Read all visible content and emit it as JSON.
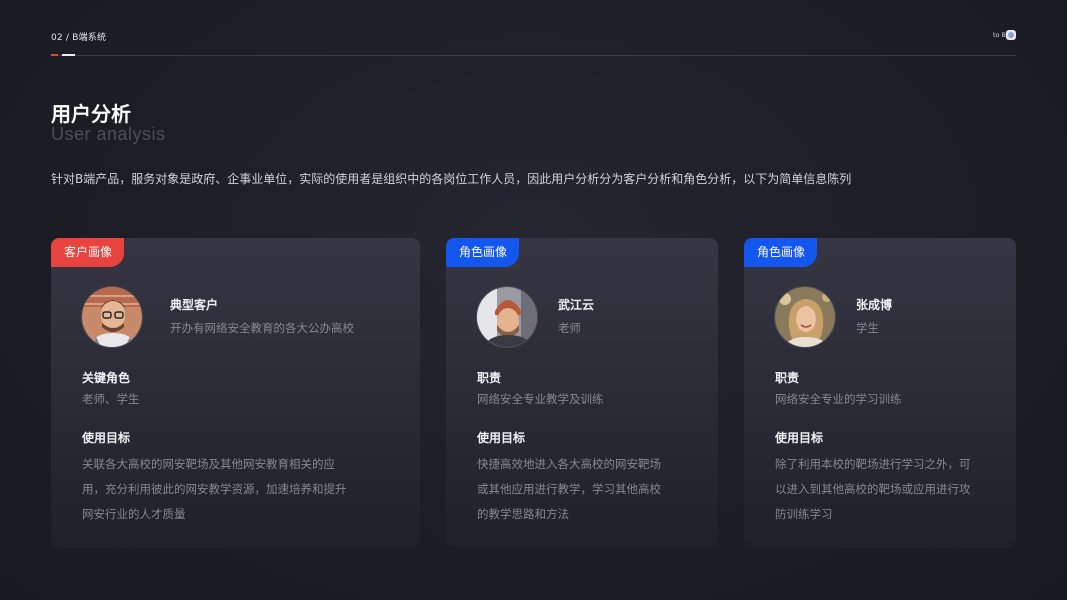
{
  "header": {
    "breadcrumb": "02 / B端系统",
    "right_label": "to B"
  },
  "page": {
    "title": "用户分析",
    "subtitle": "User analysis",
    "intro": "针对B端产品，服务对象是政府、企事业单位，实际的使用者是组织中的各岗位工作人员，因此用户分析分为客户分析和角色分析，以下为简单信息陈列"
  },
  "cards": [
    {
      "tag": "客户画像",
      "tag_color": "#e8433e",
      "name": "典型客户",
      "desc": "开办有网络安全教育的各大公办高校",
      "section1_title": "关键角色",
      "section1_text": "老师、学生",
      "section2_title": "使用目标",
      "section2_lines": [
        "关联各大高校的网安靶场及其他网安教育相关的应",
        "用，充分利用彼此的网安教学资源，加速培养和提升",
        "网安行业的人才质量"
      ],
      "avatar_icon": "avatar-man-glasses"
    },
    {
      "tag": "角色画像",
      "tag_color": "#1457ef",
      "name": "武江云",
      "desc": "老师",
      "section1_title": "职责",
      "section1_text": "网络安全专业教学及训练",
      "section2_title": "使用目标",
      "section2_lines": [
        "快捷高效地进入各大高校的网安靶场",
        "或其他应用进行教学，学习其他高校",
        "的教学思路和方法"
      ],
      "avatar_icon": "avatar-man-beanie"
    },
    {
      "tag": "角色画像",
      "tag_color": "#1457ef",
      "name": "张成博",
      "desc": "学生",
      "section1_title": "职责",
      "section1_text": "网络安全专业的学习训练",
      "section2_title": "使用目标",
      "section2_lines": [
        "除了利用本校的靶场进行学习之外，可",
        "以进入到其他高校的靶场或应用进行攻",
        "防训练学习"
      ],
      "avatar_icon": "avatar-woman"
    }
  ]
}
